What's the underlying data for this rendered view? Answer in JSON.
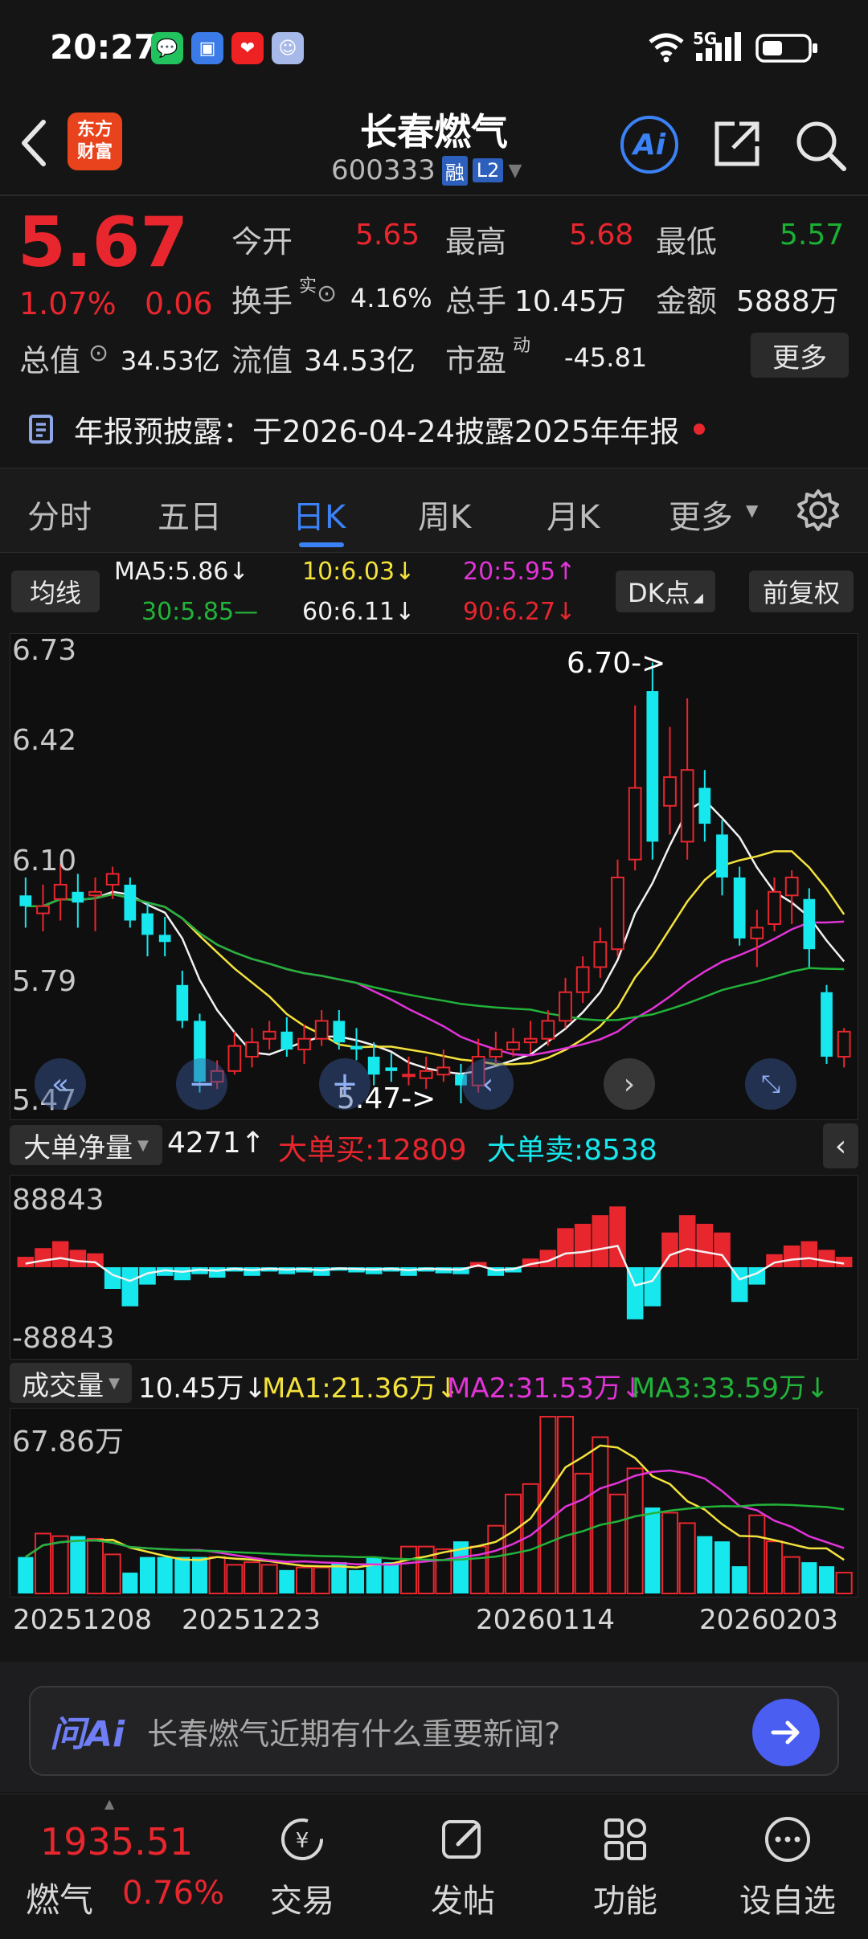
{
  "status_bar": {
    "time": "20:27",
    "network": "5G"
  },
  "header": {
    "logo_line1": "东方",
    "logo_line2": "财富",
    "stock_name": "长春燃气",
    "stock_code": "600333",
    "badge_rong": "融",
    "badge_l2": "L2",
    "ai_label": "Ai"
  },
  "quote": {
    "price": "5.67",
    "change_pct": "1.07%",
    "change_abs": "0.06",
    "open_label": "今开",
    "open": "5.65",
    "high_label": "最高",
    "high": "5.68",
    "low_label": "最低",
    "low": "5.57",
    "turnover_label": "换手",
    "turnover_sup": "实",
    "turnover": "4.16%",
    "volume_label": "总手",
    "volume": "10.45万",
    "amount_label": "金额",
    "amount": "5888万",
    "mktcap_label": "总值",
    "mktcap": "34.53亿",
    "float_label": "流值",
    "float": "34.53亿",
    "pe_label": "市盈",
    "pe_sup": "动",
    "pe": "-45.81",
    "more_label": "更多"
  },
  "notice": {
    "text": "年报预披露：于2026-04-24披露2025年年报"
  },
  "tabs": [
    "分时",
    "五日",
    "日K",
    "周K",
    "月K",
    "更多"
  ],
  "active_tab": "日K",
  "ma_legend": {
    "chip": "均线",
    "ma5": "MA5:5.86↓",
    "ma10": "10:6.03↓",
    "ma20": "20:5.95↑",
    "ma30": "30:5.85—",
    "ma60": "60:6.11↓",
    "ma90": "90:6.27↓",
    "dk_label": "DK点",
    "fq_label": "前复权"
  },
  "kline": {
    "y_labels": [
      "6.73",
      "6.42",
      "6.10",
      "5.79",
      "5.47"
    ],
    "max_mark": "6.70->",
    "min_mark": "5.47->"
  },
  "flow": {
    "chip": "大单净量",
    "value": "4271↑",
    "buy": "大单买:12809",
    "sell": "大单卖:8538",
    "top": "88843",
    "bottom": "-88843"
  },
  "volume_panel": {
    "chip": "成交量",
    "value": "10.45万↓",
    "ma1": "MA1:21.36万↓",
    "ma2": "MA2:31.53万↓",
    "ma3": "MA3:33.59万↓",
    "top": "67.86万"
  },
  "dates": [
    "20251208",
    "20251223",
    "20260114",
    "20260203"
  ],
  "ask_ai": {
    "logo": "问Ai",
    "placeholder": "长春燃气近期有什么重要新闻?"
  },
  "bottom_nav": {
    "index_value": "1935.51",
    "index_name": "燃气",
    "index_change": "0.76%",
    "trade": "交易",
    "post": "发帖",
    "function": "功能",
    "watch": "设自选"
  },
  "colors": {
    "up": "#e8262e",
    "down": "#19b033",
    "cyan": "#16e8ee",
    "accent": "#3b82f6"
  },
  "chart_data": {
    "type": "candlestick",
    "ylim": [
      5.47,
      6.73
    ],
    "candles": [
      {
        "o": 6.05,
        "c": 6.02,
        "h": 6.1,
        "l": 5.96
      },
      {
        "o": 6.0,
        "c": 6.02,
        "h": 6.08,
        "l": 5.95
      },
      {
        "o": 6.04,
        "c": 6.08,
        "h": 6.14,
        "l": 5.98
      },
      {
        "o": 6.06,
        "c": 6.03,
        "h": 6.11,
        "l": 5.96
      },
      {
        "o": 6.05,
        "c": 6.06,
        "h": 6.1,
        "l": 5.95
      },
      {
        "o": 6.08,
        "c": 6.11,
        "h": 6.13,
        "l": 6.04
      },
      {
        "o": 6.08,
        "c": 5.98,
        "h": 6.1,
        "l": 5.96
      },
      {
        "o": 6.0,
        "c": 5.94,
        "h": 6.03,
        "l": 5.88
      },
      {
        "o": 5.94,
        "c": 5.92,
        "h": 5.99,
        "l": 5.88
      },
      {
        "o": 5.8,
        "c": 5.7,
        "h": 5.84,
        "l": 5.68
      },
      {
        "o": 5.7,
        "c": 5.53,
        "h": 5.72,
        "l": 5.5
      },
      {
        "o": 5.53,
        "c": 5.56,
        "h": 5.59,
        "l": 5.51
      },
      {
        "o": 5.56,
        "c": 5.63,
        "h": 5.67,
        "l": 5.55
      },
      {
        "o": 5.6,
        "c": 5.64,
        "h": 5.68,
        "l": 5.57
      },
      {
        "o": 5.65,
        "c": 5.67,
        "h": 5.7,
        "l": 5.62
      },
      {
        "o": 5.67,
        "c": 5.62,
        "h": 5.71,
        "l": 5.6
      },
      {
        "o": 5.62,
        "c": 5.65,
        "h": 5.69,
        "l": 5.58
      },
      {
        "o": 5.65,
        "c": 5.7,
        "h": 5.73,
        "l": 5.63
      },
      {
        "o": 5.7,
        "c": 5.64,
        "h": 5.73,
        "l": 5.62
      },
      {
        "o": 5.63,
        "c": 5.62,
        "h": 5.68,
        "l": 5.59
      },
      {
        "o": 5.6,
        "c": 5.55,
        "h": 5.64,
        "l": 5.52
      },
      {
        "o": 5.57,
        "c": 5.56,
        "h": 5.61,
        "l": 5.53
      },
      {
        "o": 5.55,
        "c": 5.55,
        "h": 5.6,
        "l": 5.52
      },
      {
        "o": 5.54,
        "c": 5.56,
        "h": 5.6,
        "l": 5.51
      },
      {
        "o": 5.55,
        "c": 5.57,
        "h": 5.62,
        "l": 5.53
      },
      {
        "o": 5.55,
        "c": 5.52,
        "h": 5.58,
        "l": 5.47
      },
      {
        "o": 5.52,
        "c": 5.6,
        "h": 5.65,
        "l": 5.5
      },
      {
        "o": 5.6,
        "c": 5.62,
        "h": 5.67,
        "l": 5.58
      },
      {
        "o": 5.62,
        "c": 5.64,
        "h": 5.68,
        "l": 5.6
      },
      {
        "o": 5.64,
        "c": 5.65,
        "h": 5.7,
        "l": 5.61
      },
      {
        "o": 5.65,
        "c": 5.7,
        "h": 5.73,
        "l": 5.63
      },
      {
        "o": 5.7,
        "c": 5.78,
        "h": 5.82,
        "l": 5.68
      },
      {
        "o": 5.78,
        "c": 5.85,
        "h": 5.88,
        "l": 5.75
      },
      {
        "o": 5.85,
        "c": 5.92,
        "h": 5.96,
        "l": 5.82
      },
      {
        "o": 5.9,
        "c": 6.1,
        "h": 6.15,
        "l": 5.88
      },
      {
        "o": 6.15,
        "c": 6.35,
        "h": 6.58,
        "l": 6.12
      },
      {
        "o": 6.62,
        "c": 6.2,
        "h": 6.7,
        "l": 6.15
      },
      {
        "o": 6.3,
        "c": 6.38,
        "h": 6.52,
        "l": 6.22
      },
      {
        "o": 6.2,
        "c": 6.4,
        "h": 6.6,
        "l": 6.15
      },
      {
        "o": 6.35,
        "c": 6.25,
        "h": 6.4,
        "l": 6.2
      },
      {
        "o": 6.22,
        "c": 6.1,
        "h": 6.26,
        "l": 6.05
      },
      {
        "o": 6.1,
        "c": 5.93,
        "h": 6.13,
        "l": 5.91
      },
      {
        "o": 5.93,
        "c": 5.96,
        "h": 6.01,
        "l": 5.85
      },
      {
        "o": 5.97,
        "c": 6.06,
        "h": 6.1,
        "l": 5.95
      },
      {
        "o": 6.05,
        "c": 6.1,
        "h": 6.12,
        "l": 5.97
      },
      {
        "o": 6.04,
        "c": 5.9,
        "h": 6.07,
        "l": 5.85
      },
      {
        "o": 5.78,
        "c": 5.6,
        "h": 5.8,
        "l": 5.58
      },
      {
        "o": 5.6,
        "c": 5.67,
        "h": 5.68,
        "l": 5.57
      }
    ],
    "flow_values": [
      12000,
      22000,
      30000,
      20000,
      16000,
      -25000,
      -45000,
      -20000,
      -10000,
      -15000,
      -8000,
      -12000,
      -5000,
      -10000,
      -5000,
      -8000,
      -6000,
      -10000,
      -4000,
      -6000,
      -8000,
      -5000,
      -10000,
      -5000,
      -7000,
      -8000,
      6000,
      -10000,
      -6000,
      10000,
      20000,
      45000,
      50000,
      60000,
      70000,
      -60000,
      -45000,
      40000,
      60000,
      50000,
      40000,
      -40000,
      -20000,
      15000,
      25000,
      30000,
      20000,
      12000
    ],
    "volume_values": [
      14,
      23,
      22,
      22,
      21,
      15,
      8,
      14,
      14,
      14,
      14,
      14,
      11,
      12,
      11,
      9,
      10,
      10,
      12,
      9,
      14,
      12,
      18,
      18,
      17,
      20,
      18,
      26,
      38,
      42,
      68,
      68,
      46,
      60,
      38,
      48,
      33,
      31,
      27,
      22,
      20,
      10.45,
      30,
      20,
      14,
      12,
      10.45,
      8
    ]
  }
}
